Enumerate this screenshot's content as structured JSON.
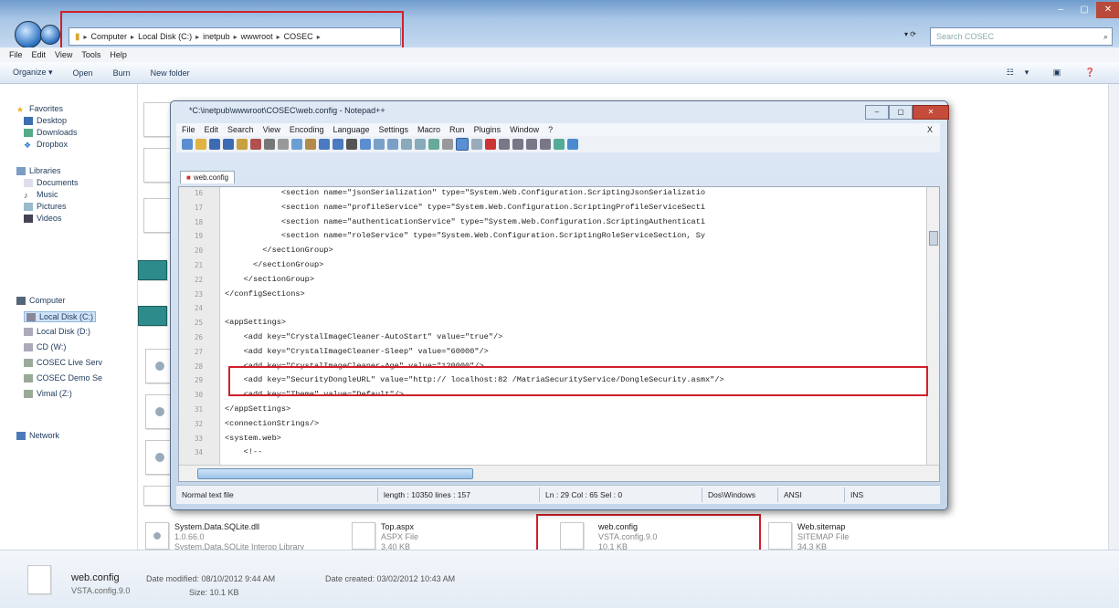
{
  "explorer": {
    "address_segments": [
      "Computer",
      "Local Disk (C:)",
      "inetpub",
      "wwwroot",
      "COSEC"
    ],
    "search_placeholder": "Search COSEC",
    "menu": [
      "File",
      "Edit",
      "View",
      "Tools",
      "Help"
    ],
    "toolbar": [
      "Organize ▾",
      "Open",
      "Burn",
      "New folder"
    ],
    "sidebar": {
      "favorites_header": "Favorites",
      "favorites": [
        "Desktop",
        "Downloads",
        "Dropbox"
      ],
      "libraries_header": "Libraries",
      "libraries": [
        "Documents",
        "Music",
        "Pictures",
        "Videos"
      ],
      "computer_header": "Computer",
      "drives": [
        "Local Disk (C:)",
        "Local Disk (D:)",
        "CD (W:)",
        "COSEC Live Serv",
        "COSEC Demo Se",
        "Vimal (Z:)"
      ],
      "network": "Network"
    },
    "files": [
      {
        "name": "System.Data.SQLite.dll",
        "line2": "1.0.66.0",
        "line3": "System.Data.SQLite Interop Library"
      },
      {
        "name": "Top.aspx",
        "line2": "ASPX File",
        "line3": "3.40 KB"
      },
      {
        "name": "web.config",
        "line2": "VSTA.config.9.0",
        "line3": "10.1 KB"
      },
      {
        "name": "Web.sitemap",
        "line2": "SITEMAP File",
        "line3": "34.3 KB"
      }
    ],
    "details": {
      "name": "web.config",
      "type": "VSTA.config.9.0",
      "modified": "Date modified: 08/10/2012 9:44 AM",
      "created": "Date created: 03/02/2012 10:43 AM",
      "size": "Size: 10.1 KB"
    }
  },
  "notepad": {
    "title": "*C:\\inetpub\\wwwroot\\COSEC\\web.config - Notepad++",
    "menu": [
      "File",
      "Edit",
      "Search",
      "View",
      "Encoding",
      "Language",
      "Settings",
      "Macro",
      "Run",
      "Plugins",
      "Window",
      "?"
    ],
    "tab": "web.config",
    "lines": [
      {
        "n": "16",
        "t": "            <section name=\"jsonSerialization\" type=\"System.Web.Configuration.ScriptingJsonSerializatio"
      },
      {
        "n": "17",
        "t": "            <section name=\"profileService\" type=\"System.Web.Configuration.ScriptingProfileServiceSecti"
      },
      {
        "n": "18",
        "t": "            <section name=\"authenticationService\" type=\"System.Web.Configuration.ScriptingAuthenticati"
      },
      {
        "n": "19",
        "t": "            <section name=\"roleService\" type=\"System.Web.Configuration.ScriptingRoleServiceSection, Sy"
      },
      {
        "n": "20",
        "t": "        </sectionGroup>"
      },
      {
        "n": "21",
        "t": "      </sectionGroup>"
      },
      {
        "n": "22",
        "t": "    </sectionGroup>"
      },
      {
        "n": "23",
        "t": "</configSections>"
      },
      {
        "n": "24",
        "t": ""
      },
      {
        "n": "25",
        "t": "<appSettings>"
      },
      {
        "n": "26",
        "t": "    <add key=\"CrystalImageCleaner-AutoStart\" value=\"true\"/>"
      },
      {
        "n": "27",
        "t": "    <add key=\"CrystalImageCleaner-Sleep\" value=\"60000\"/>"
      },
      {
        "n": "28",
        "t": "    <add key=\"CrystalImageCleaner-Age\" value=\"120000\"/>"
      },
      {
        "n": "29",
        "t": "    <add key=\"SecurityDongleURL\" value=\"http:// localhost:82 /MatriaSecurityService/DongleSecurity.asmx\"/>"
      },
      {
        "n": "30",
        "t": "    <add key=\"Theme\" value=\"Default\"/>"
      },
      {
        "n": "31",
        "t": "</appSettings>"
      },
      {
        "n": "32",
        "t": "<connectionStrings/>"
      },
      {
        "n": "33",
        "t": "<system.web>"
      },
      {
        "n": "34",
        "t": "    <!--"
      }
    ],
    "status": {
      "type": "Normal text file",
      "length": "length : 10350   lines : 157",
      "pos": "Ln : 29   Col : 65   Sel : 0",
      "eol": "Dos\\Windows",
      "enc": "ANSI",
      "mode": "INS"
    }
  }
}
